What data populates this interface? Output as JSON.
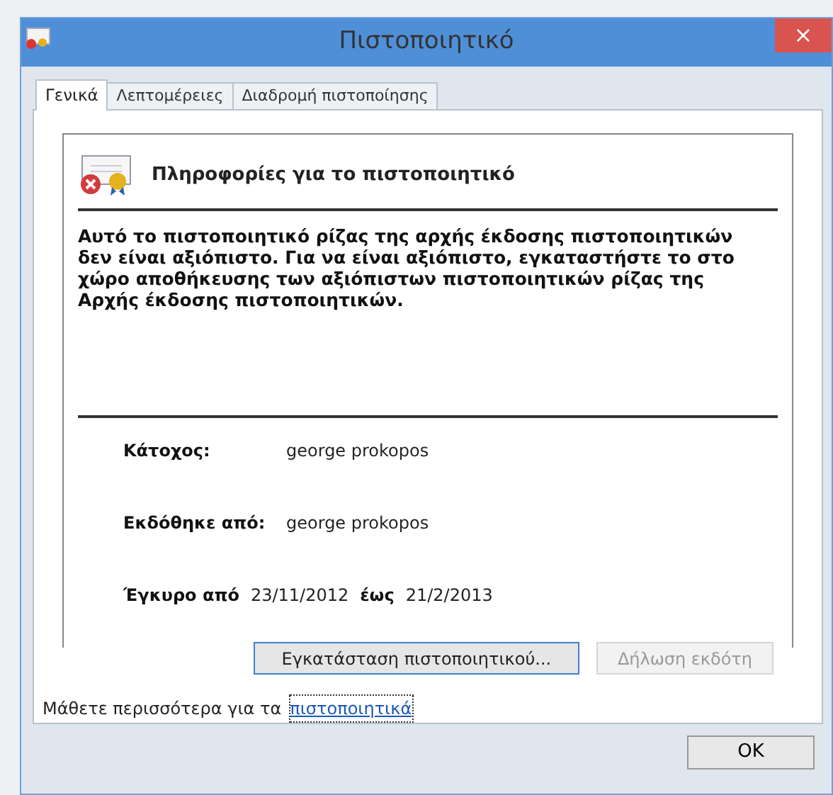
{
  "window": {
    "title": "Πιστοποιητικό",
    "close": "×"
  },
  "tabs": [
    {
      "label": "Γενικά",
      "selected": true
    },
    {
      "label": "Λεπτομέρειες",
      "selected": false
    },
    {
      "label": "Διαδρομή πιστοποίησης",
      "selected": false
    }
  ],
  "info": {
    "heading": "Πληροφορίες για το πιστοποιητικό",
    "message": "Αυτό το πιστοποιητικό ρίζας της αρχής έκδοσης πιστοποιητικών δεν είναι αξιόπιστο. Για να είναι αξιόπιστο, εγκαταστήστε το στο χώρο αποθήκευσης των αξιόπιστων πιστοποιητικών ρίζας της Αρχής έκδοσης πιστοποιητικών."
  },
  "fields": [
    {
      "label": "Κάτοχος:",
      "value": "george prokopos"
    },
    {
      "label": "Εκδόθηκε από:",
      "value": "george prokopos"
    }
  ],
  "validity": {
    "from_label": "Έγκυρο από",
    "from": "23/11/2012",
    "to_label": "έως",
    "to": "21/2/2013"
  },
  "buttons": [
    {
      "label": "Εγκατάσταση πιστοποιητικού...",
      "disabled": false
    },
    {
      "label": "Δήλωση εκδότη",
      "disabled": true
    }
  ],
  "learn_more": {
    "text": "Μάθετε περισσότερα για τα",
    "link": "πιστοποιητικά"
  },
  "ok": "OK"
}
